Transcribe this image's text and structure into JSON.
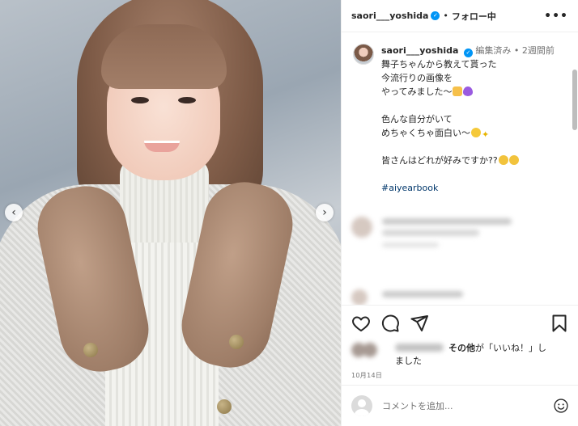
{
  "post": {
    "username": "saori___yoshida",
    "follow_label": "フォロー中",
    "dot": "•",
    "more": "•••"
  },
  "caption": {
    "username": "saori___yoshida",
    "edited": "編集済み",
    "dot": "•",
    "time_ago": "2週間前",
    "lines": [
      "舞子ちゃんから教えて貰った",
      "今流行りの画像を",
      "やってみました〜",
      "色んな自分がいて",
      "めちゃくちゃ面白い〜",
      "皆さんはどれが好みですか??"
    ],
    "hashtag": "#aiyearbook"
  },
  "likes": {
    "suffix_bold": "その他",
    "suffix_text": "が「いいね！」し",
    "line2": "ました"
  },
  "date": "10月14日",
  "comment": {
    "placeholder": "コメントを追加..."
  },
  "nav": {
    "prev": "‹",
    "next": "›"
  },
  "icons": [
    "heart-icon",
    "comment-icon",
    "share-icon",
    "bookmark-icon",
    "emoji-icon",
    "verified-icon",
    "more-icon"
  ],
  "colors": {
    "verified": "#0095f6",
    "hashtag": "#00376b",
    "muted": "#737373",
    "text": "#262626"
  }
}
